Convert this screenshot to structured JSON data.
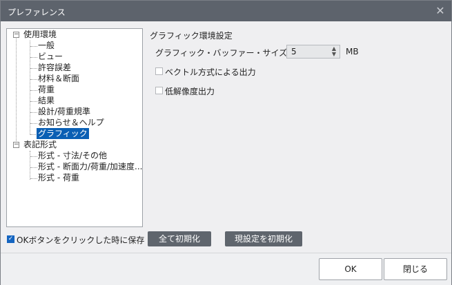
{
  "window": {
    "title": "プレファレンス"
  },
  "tree": {
    "group1": {
      "label": "使用環境",
      "toggle": "−",
      "items": [
        "一般",
        "ビュー",
        "許容誤差",
        "材料＆断面",
        "荷重",
        "結果",
        "設計/荷重規準",
        "お知らせ＆ヘルプ",
        "グラフィック"
      ]
    },
    "group2": {
      "label": "表記形式",
      "toggle": "−",
      "items": [
        "形式 - 寸法/その他",
        "形式 - 断面力/荷重/加速度...",
        "形式 - 荷重"
      ]
    },
    "selected": "グラフィック"
  },
  "panel": {
    "section_title": "グラフィック環境設定",
    "buffer_label": "グラフィック・バッファー・サイズ",
    "buffer_value": "5",
    "buffer_unit": "MB",
    "vector_output_label": "ベクトル方式による出力",
    "vector_output_checked": false,
    "lowres_output_label": "低解像度出力",
    "lowres_output_checked": false
  },
  "bottom": {
    "save_on_ok_label": "OKボタンをクリックした時に保存",
    "save_on_ok_checked": true,
    "reset_all_label": "全て初期化",
    "reset_current_label": "現設定を初期化"
  },
  "footer": {
    "ok_label": "OK",
    "close_label": "閉じる"
  },
  "icons": {
    "close": "✕",
    "check": "✓",
    "spinner_up": "▲",
    "spinner_down": "▼"
  }
}
